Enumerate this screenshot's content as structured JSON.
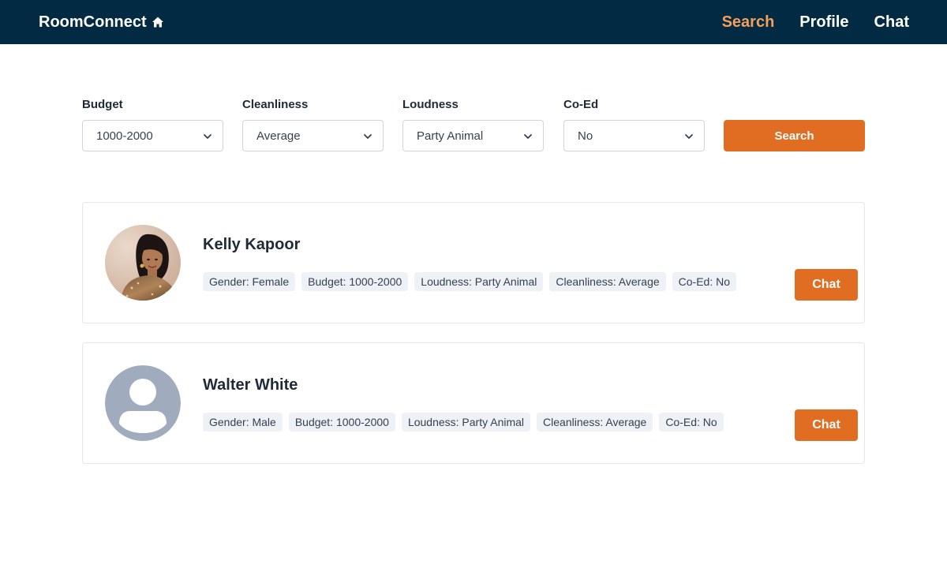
{
  "nav": {
    "brand": "RoomConnect",
    "brand_icon": "home-icon",
    "links": [
      {
        "label": "Search",
        "active": true
      },
      {
        "label": "Profile",
        "active": false
      },
      {
        "label": "Chat",
        "active": false
      }
    ]
  },
  "filters": [
    {
      "label": "Budget",
      "value": "1000-2000"
    },
    {
      "label": "Cleanliness",
      "value": "Average"
    },
    {
      "label": "Loudness",
      "value": "Party Animal"
    },
    {
      "label": "Co-Ed",
      "value": "No"
    }
  ],
  "search_button": "Search",
  "results": [
    {
      "name": "Kelly Kapoor",
      "avatar": "profile-photo",
      "tags": [
        "Gender: Female",
        "Budget: 1000-2000",
        "Loudness: Party Animal",
        "Cleanliness: Average",
        "Co-Ed: No"
      ],
      "chat_label": "Chat"
    },
    {
      "name": "Walter White",
      "avatar": "default-avatar-icon",
      "tags": [
        "Gender: Male",
        "Budget: 1000-2000",
        "Loudness: Party Animal",
        "Cleanliness: Average",
        "Co-Ed: No"
      ],
      "chat_label": "Chat"
    }
  ],
  "colors": {
    "navbar": "#022a42",
    "active_link": "#f5a05a",
    "accent": "#e06d22",
    "tag_bg": "#eef1f5",
    "avatar_placeholder": "#a0acbd"
  }
}
